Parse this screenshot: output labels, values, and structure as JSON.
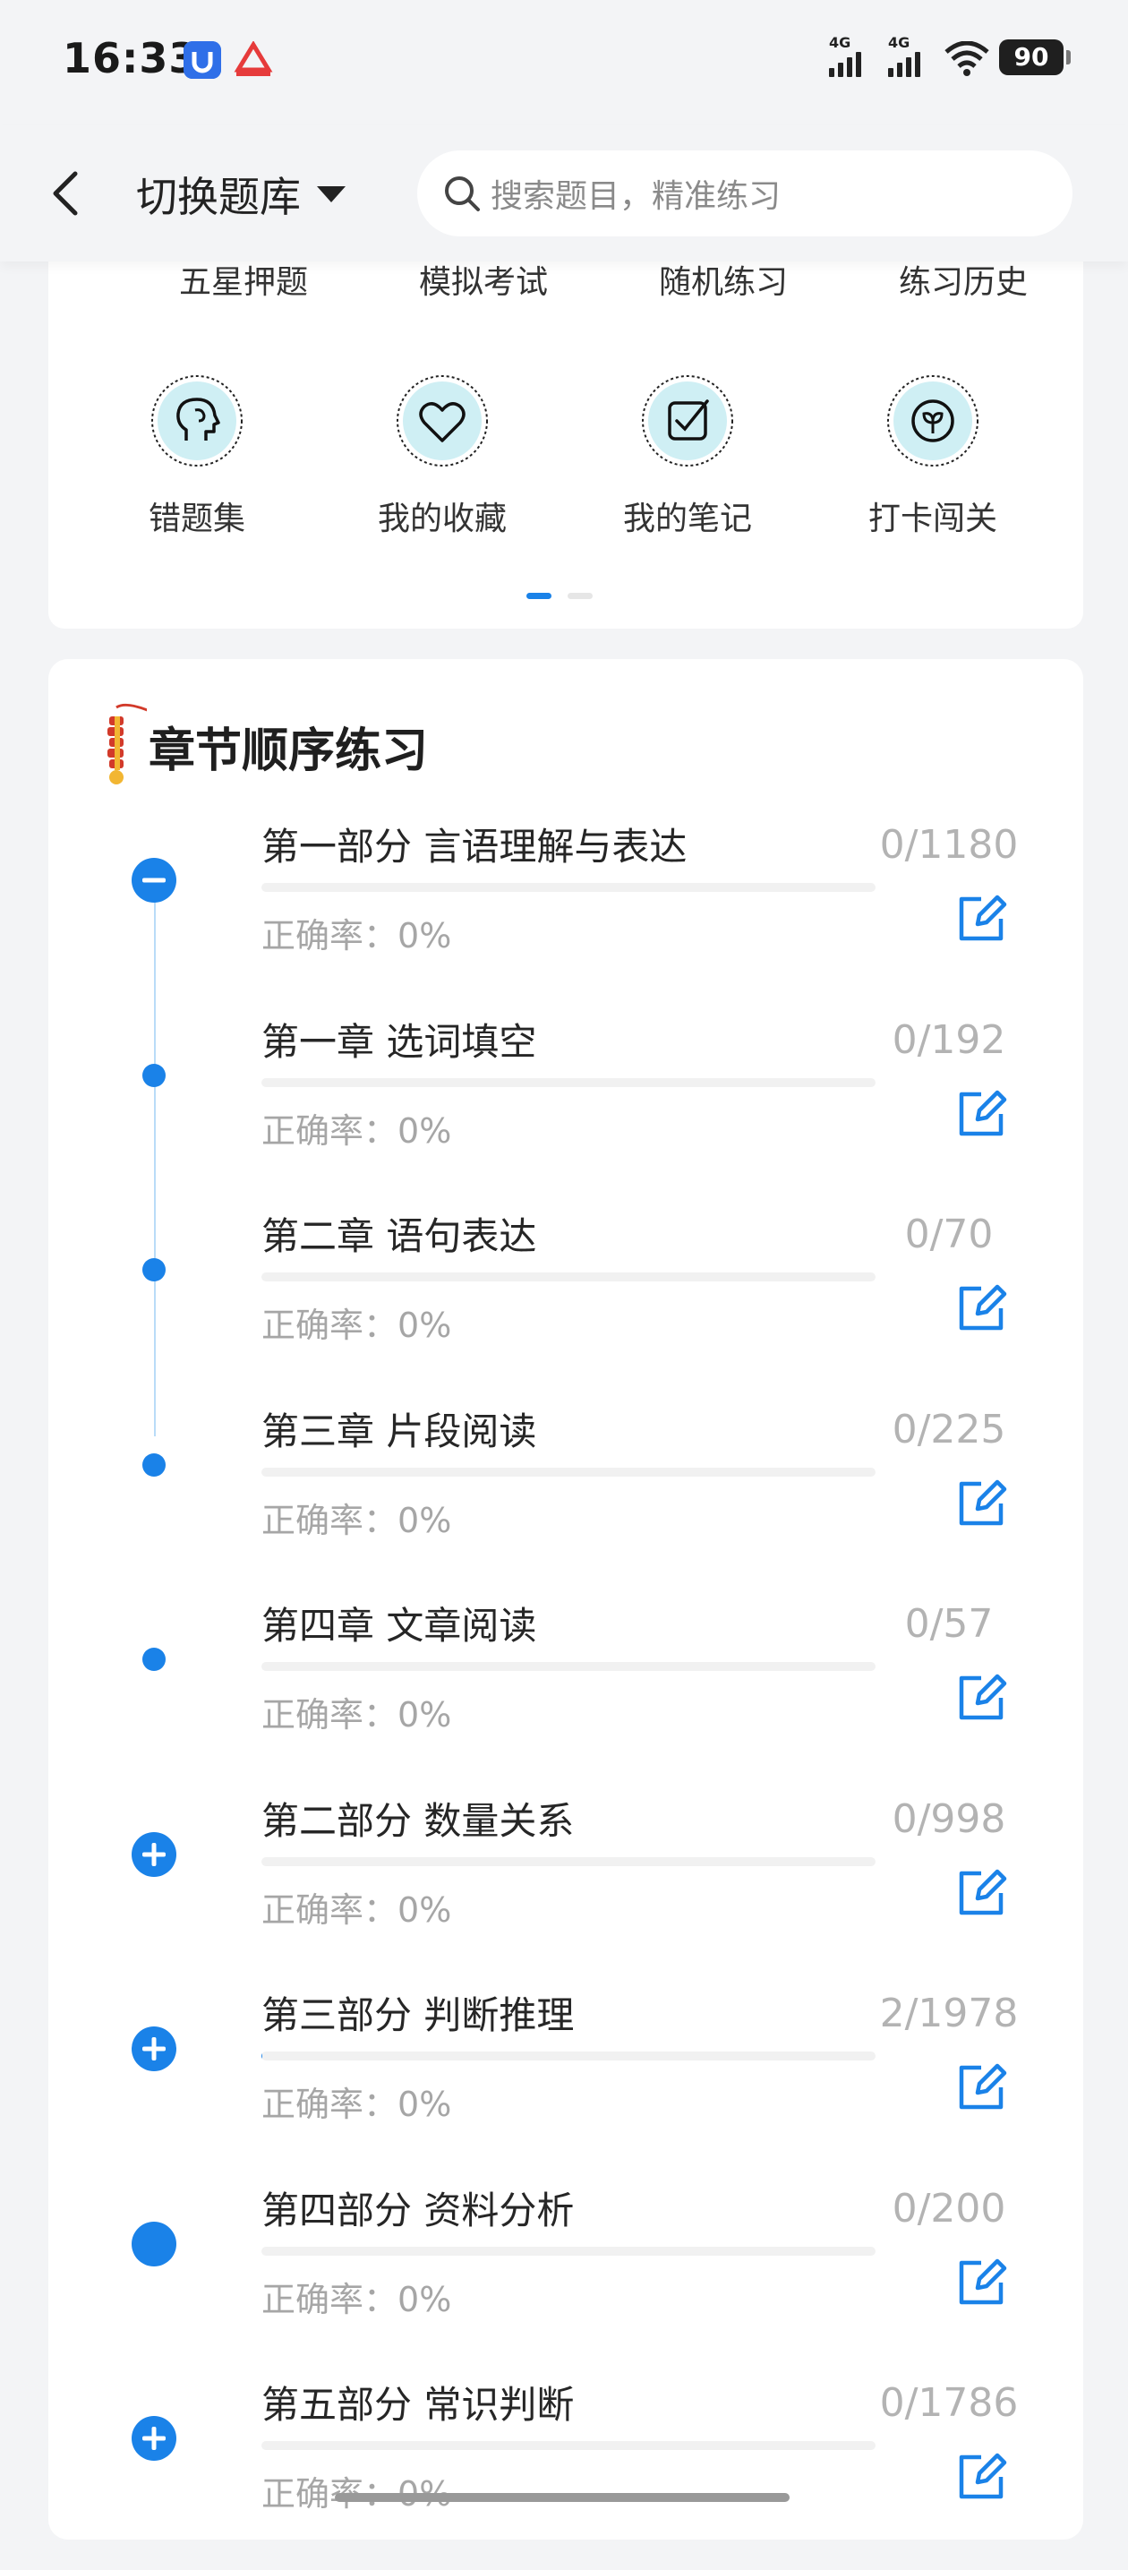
{
  "status_bar": {
    "time": "16:33",
    "signal1": "4G",
    "signal2": "4G",
    "battery": "90"
  },
  "header": {
    "bank_switch_label": "切换题库",
    "search_placeholder": "搜索题目，精准练习"
  },
  "tools": {
    "row1": [
      "五星押题",
      "模拟考试",
      "随机练习",
      "练习历史"
    ],
    "row2": [
      {
        "label": "错题集",
        "icon": "head-icon"
      },
      {
        "label": "我的收藏",
        "icon": "heart-icon"
      },
      {
        "label": "我的笔记",
        "icon": "checkbox-icon"
      },
      {
        "label": "打卡闯关",
        "icon": "sprout-icon"
      }
    ],
    "page_indicator": {
      "pages": 2,
      "active": 1
    }
  },
  "chapter": {
    "title": "章节顺序练习",
    "accuracy_prefix": "正确率：",
    "items": [
      {
        "name": "第一部分 言语理解与表达",
        "count": "0/1180",
        "accuracy": "0%",
        "node": "collapse",
        "progress": 0
      },
      {
        "name": "第一章 选词填空",
        "count": "0/192",
        "accuracy": "0%",
        "node": "dot",
        "progress": 0
      },
      {
        "name": "第二章 语句表达",
        "count": "0/70",
        "accuracy": "0%",
        "node": "dot",
        "progress": 0
      },
      {
        "name": "第三章 片段阅读",
        "count": "0/225",
        "accuracy": "0%",
        "node": "dot",
        "progress": 0
      },
      {
        "name": "第四章 文章阅读",
        "count": "0/57",
        "accuracy": "0%",
        "node": "dot",
        "progress": 0
      },
      {
        "name": "第二部分 数量关系",
        "count": "0/998",
        "accuracy": "0%",
        "node": "expand",
        "progress": 0
      },
      {
        "name": "第三部分 判断推理",
        "count": "2/1978",
        "accuracy": "0%",
        "node": "expand",
        "progress": 0.001
      },
      {
        "name": "第四部分 资料分析",
        "count": "0/200",
        "accuracy": "0%",
        "node": "solid",
        "progress": 0
      },
      {
        "name": "第五部分 常识判断",
        "count": "0/1786",
        "accuracy": "0%",
        "node": "expand",
        "progress": 0
      }
    ]
  },
  "colors": {
    "accent": "#1a82e8",
    "background": "#f3f4f6"
  }
}
